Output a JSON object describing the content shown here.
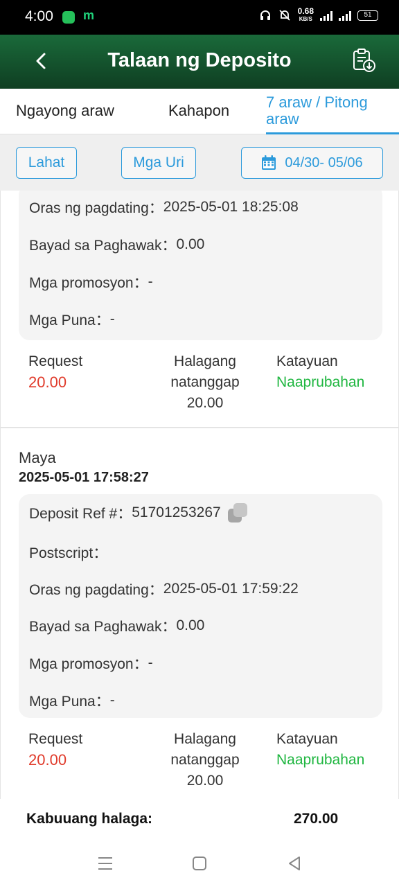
{
  "status_bar": {
    "time": "4:00",
    "app_letter": "m",
    "net_speed": "0.68",
    "net_unit": "KB/S",
    "battery": "51"
  },
  "header": {
    "title": "Talaan ng Deposito",
    "back_icon": "chevron-left-icon",
    "action_icon": "clipboard-download-icon"
  },
  "tabs": [
    {
      "label": "Ngayong araw",
      "active": false
    },
    {
      "label": "Kahapon",
      "active": false
    },
    {
      "label": "7 araw / Pitong araw",
      "active": true
    }
  ],
  "filters": {
    "all_label": "Lahat",
    "types_label": "Mga Uri",
    "date_range": "04/30- 05/06"
  },
  "labels": {
    "ref": "Deposit Ref #",
    "postscript": "Postscript",
    "arrival": "Oras ng pagdating",
    "fee": "Bayad sa Paghawak",
    "promos": "Mga promosyon",
    "remarks": "Mga Puna",
    "request": "Request",
    "received": "Halagang natanggap",
    "status": "Katayuan"
  },
  "records": [
    {
      "arrival": "2025-05-01 18:25:08",
      "fee": "0.00",
      "promos": "-",
      "remarks": "-",
      "request": "20.00",
      "received": "20.00",
      "status": "Naaprubahan"
    },
    {
      "method": "Maya",
      "created": "2025-05-01 17:58:27",
      "ref": "51701253267",
      "postscript": "",
      "arrival": "2025-05-01 17:59:22",
      "fee": "0.00",
      "promos": "-",
      "remarks": "-",
      "request": "20.00",
      "received": "20.00",
      "status": "Naaprubahan"
    }
  ],
  "total": {
    "label": "Kabuuang halaga:",
    "value": "270.00"
  },
  "colors": {
    "header_top": "#1a6a3a",
    "header_bottom": "#0f3e22",
    "accent_blue": "#2b9adb",
    "request_red": "#e03a2a",
    "approved_green": "#1fb640"
  }
}
